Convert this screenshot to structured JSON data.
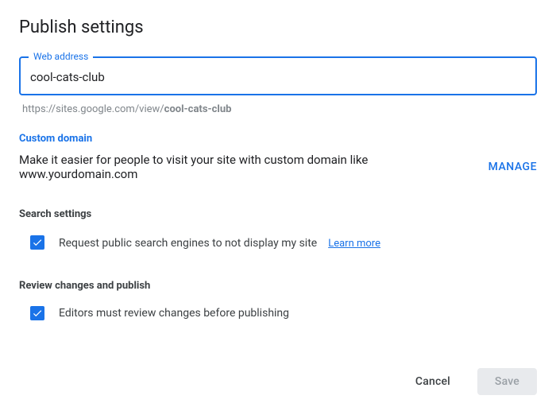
{
  "title": "Publish settings",
  "web_address": {
    "label": "Web address",
    "value": "cool-cats-club",
    "helper_prefix": "https://sites.google.com/view/",
    "helper_slug": "cool-cats-club"
  },
  "custom_domain": {
    "heading": "Custom domain",
    "description": "Make it easier for people to visit your site with custom domain like www.yourdomain.com",
    "manage_label": "MANAGE"
  },
  "search": {
    "heading": "Search settings",
    "checkbox_label": "Request public search engines to not display my site",
    "checked": true,
    "learn_more": "Learn more"
  },
  "review": {
    "heading": "Review changes and publish",
    "checkbox_label": "Editors must review changes before publishing",
    "checked": true
  },
  "actions": {
    "cancel": "Cancel",
    "save": "Save"
  }
}
